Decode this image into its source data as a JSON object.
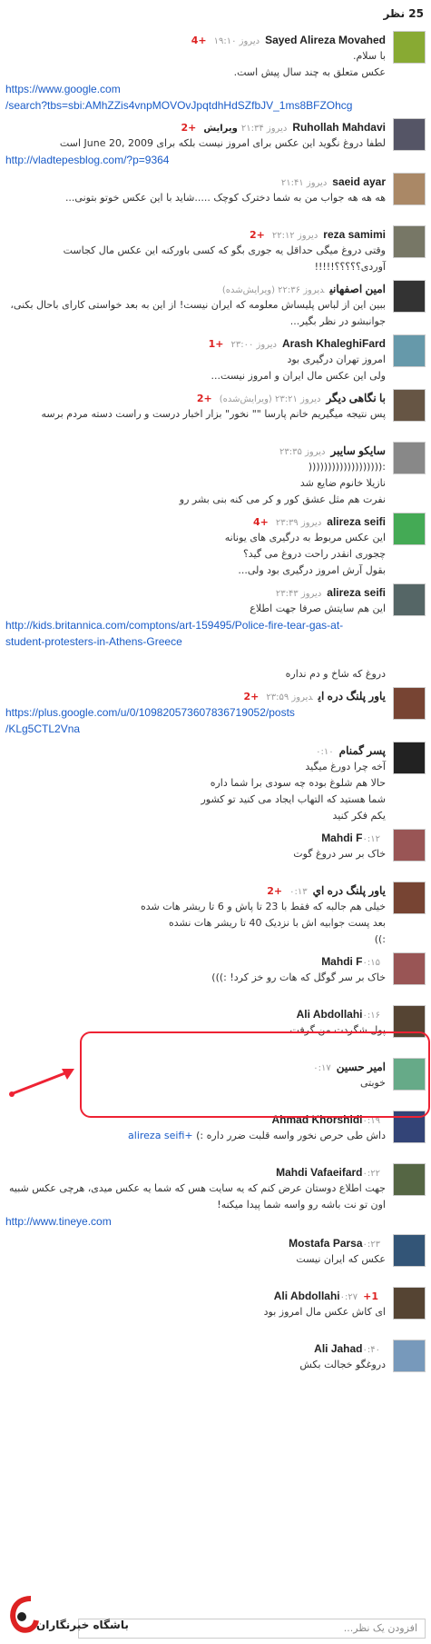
{
  "header": {
    "count_label": "25 نظر"
  },
  "comments": [
    {
      "author": "Sayed Alireza Movahed",
      "time": "دیروز ۱۹:۱۰",
      "plus": "+4",
      "edited": "",
      "lines": [
        "با سلام.",
        "عکس متعلق به چند سال پیش است."
      ],
      "links": [
        "https://www.google.com",
        "/search?tbs=sbi:AMhZZis4vnpMOVOvJpqtdhHdSZfbJV_1ms8BFZOhcg"
      ]
    },
    {
      "author": "Ruhollah Mahdavi",
      "time": "دیروز ۲۱:۳۴",
      "plus": "+2",
      "edited": "ویرایش",
      "lines": [
        "لطفا دروغ نگوید این عکس برای امروز نیست بلکه برای June 20, 2009 است"
      ],
      "links": [
        "http://vladtepesblog.com/?p=9364"
      ]
    },
    {
      "author": "saeid ayar",
      "time": "دیروز ۲۱:۴۱",
      "plus": "",
      "edited": "",
      "lines": [
        "هه هه هه جواب من به شما دخترک کوچک .....شاید با این عکس خوتو بتونی..."
      ],
      "links": []
    },
    {
      "author": "reza samimi",
      "time": "دیروز ۲۲:۱۲",
      "plus": "+2",
      "edited": "",
      "lines": [
        "وقتی دروغ میگی حداقل یه جوری بگو که کسی باورکنه این عکس مال کجاست",
        "آوردی؟؟؟؟؟!!!!!"
      ],
      "links": []
    },
    {
      "author": "امین اصفهانی",
      "time": "دیروز ۲۲:۳۶ (ویرایش‌شده)",
      "plus": "",
      "edited": "",
      "lines": [
        "ببین این از لباس پلیساش معلومه که ایران نیست! از این به بعد خواستی کارای باحال بکنی،",
        "جوانبشو در نظر بگیر..."
      ],
      "links": []
    },
    {
      "author": "Arash KhaleghiFard",
      "time": "دیروز ۲۳:۰۰",
      "plus": "+1",
      "edited": "",
      "lines": [
        "امروز تهران درگیری بود",
        "ولی این عکس مال ایران و امروز نیست..."
      ],
      "links": []
    },
    {
      "author": "با نگاهی دیگر",
      "time": "دیروز ۲۳:۲۱ (ویرایش‌شده)",
      "plus": "+2",
      "edited": "",
      "lines": [
        "پس نتیجه میگیریم خانم پارسا \"\" نخور\" بزار اخبار درست و راست دسته مردم برسه"
      ],
      "links": []
    },
    {
      "author": "سایکو سایبر",
      "time": "دیروز ۲۳:۳۵",
      "plus": "",
      "edited": "",
      "lines": [
        ":(((((((((((((((((((",
        "نازیلا خانوم ضایع شد",
        "نفرت هم مثل عشق کور و کر می کنه بنی بشر رو"
      ],
      "links": []
    },
    {
      "author": "alireza seifi",
      "time": "دیروز ۲۳:۳۹",
      "plus": "+4",
      "edited": "",
      "lines": [
        "این عکس مربوط به درگیری های یونانه",
        "چجوری انقدر راحت دروغ می گید؟",
        "بقول آرش امروز درگیری بود ولی..."
      ],
      "links": []
    },
    {
      "author": "alireza seifi",
      "time": "دیروز ۲۳:۴۳",
      "plus": "",
      "edited": "",
      "lines": [
        "این هم سایتش صرفا جهت اطلاع"
      ],
      "links": [
        "http://kids.britannica.com/comptons/art-159495/Police-fire-tear-gas-at-",
        "student-protesters-in-Athens-Greece"
      ],
      "after": [
        "دروغ که شاخ و دم نداره"
      ]
    },
    {
      "author": "ياور پلنگ دره اي",
      "time": "دیروز ۲۳:۵۹",
      "plus": "+2",
      "edited": "",
      "lines": [],
      "links": [
        "https://plus.google.com/u/0/109820573607836719052/posts",
        "/KLg5CTL2Vna"
      ]
    },
    {
      "author": "پسر گمنام",
      "time": "۰:۱۰",
      "plus": "",
      "edited": "",
      "lines": [
        "آخه چرا دورغ میگید",
        "حالا هم شلوغ بوده چه سودی برا شما داره",
        "شما هستید که التهاب ایجاد می کنید تو کشور",
        "یکم فکر کنید"
      ],
      "links": []
    },
    {
      "author": "Mahdi F",
      "time": "۰:۱۲",
      "plus": "",
      "edited": "",
      "lines": [
        "خاک بر سر دروغ گوت"
      ],
      "links": []
    },
    {
      "author": "ياور پلنگ دره اي",
      "time": "۰:۱۳",
      "plus": "+2",
      "edited": "",
      "lines": [
        "خیلی هم جالبه که فقط با 23 تا پاش و 6 تا ریشر هات شده",
        "بعد پست جوابیه اش با نزدیک 40 تا ریشر هات نشده",
        ":))"
      ],
      "links": []
    },
    {
      "author": "Mahdi F",
      "time": "۰:۱۵",
      "plus": "",
      "edited": "",
      "lines": [
        "خاک بر سر گوگل که هات رو خز کرد! :)))"
      ],
      "links": []
    },
    {
      "author": "Ali Abdollahi",
      "time": "۰:۱۶",
      "plus": "",
      "edited": "",
      "lines": [
        "پول شگردت من گرفت..."
      ],
      "links": []
    },
    {
      "author": "امیر حسین",
      "time": "۰:۱۷",
      "plus": "",
      "edited": "",
      "lines": [
        "خوبتی"
      ],
      "links": []
    },
    {
      "author": "Ahmad Khorshidi",
      "time": "۰:۱۹",
      "plus": "",
      "edited": "",
      "lines": [
        "داش طی حرص نخور واسه قلبت ضرر داره :)"
      ],
      "mention": "+alireza seifi",
      "links": []
    },
    {
      "author": "Mahdi Vafaeifard",
      "time": "۰:۲۲",
      "plus": "",
      "edited": "",
      "lines": [
        "جهت اطلاع دوستان عرض کنم که یه سایت هس که شما یه عکس میدی، هرچی عکس شبیه",
        "اون تو نت باشه رو واسه شما پیدا میکنه!"
      ],
      "links": [
        "http://www.tineye.com"
      ]
    },
    {
      "author": "Mostafa Parsa",
      "time": "۰:۲۳",
      "plus": "",
      "edited": "",
      "lines": [
        "عکس که ایران نیست"
      ],
      "links": []
    },
    {
      "author": "Ali Abdollahi",
      "time": "۰:۲۷",
      "plus": "+1",
      "edited": "",
      "lines": [
        "ای کاش عکس مال امروز بود"
      ],
      "links": []
    },
    {
      "author": "Ali Jahad",
      "time": "۰:۴۰",
      "plus": "",
      "edited": "",
      "lines": [
        "دروغگو خجالت بکش"
      ],
      "links": []
    }
  ],
  "footer": {
    "input_placeholder": "افزودن یک نظر...",
    "logo_text": "باشگاه خبرنگاران"
  },
  "colors": {
    "link": "#1a5cc8",
    "plus": "#d22",
    "highlight": "#e23"
  }
}
